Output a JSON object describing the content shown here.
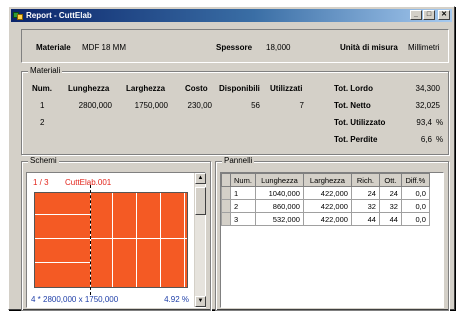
{
  "window": {
    "title": "Report - CuttElab",
    "icon": "app-icon",
    "buttons": [
      "minimize-icon",
      "maximize-icon",
      "close-icon"
    ]
  },
  "header": {
    "materiale_label": "Materiale",
    "materiale_value": "MDF 18 MM",
    "spessore_label": "Spessore",
    "spessore_value": "18,000",
    "unita_label": "Unità di misura",
    "unita_value": "Millimetri"
  },
  "materiali": {
    "title": "Materiali",
    "columns": [
      "Num.",
      "Lunghezza",
      "Larghezza",
      "Costo",
      "Disponibili",
      "Utilizzati"
    ],
    "rows": [
      [
        "1",
        "2800,000",
        "1750,000",
        "230,00",
        "56",
        "7"
      ],
      [
        "2",
        "",
        "",
        "",
        "",
        ""
      ]
    ],
    "totals": [
      {
        "label": "Tot. Lordo",
        "value": "34,300",
        "unit": ""
      },
      {
        "label": "Tot. Netto",
        "value": "32,025",
        "unit": ""
      },
      {
        "label": "Tot. Utilizzato",
        "value": "93,4",
        "unit": "%"
      },
      {
        "label": "Tot. Perdite",
        "value": "6,6",
        "unit": "%"
      }
    ]
  },
  "schemi": {
    "title": "Schemi",
    "page": "1 / 3",
    "name": "CuttElab.001",
    "footer_left": "4 * 2800,000 x 1750,000",
    "footer_right": "4.92 %",
    "sheet_color": "#f45a24",
    "accent_color": "#e2231a",
    "footer_color": "#1f3fa8"
  },
  "pannelli": {
    "title": "Pannelli",
    "columns": [
      "Num.",
      "Lunghezza",
      "Larghezza",
      "Rich.",
      "Ott.",
      "Diff.%"
    ],
    "rows": [
      [
        "1",
        "1040,000",
        "422,000",
        "24",
        "24",
        "0,0"
      ],
      [
        "2",
        "860,000",
        "422,000",
        "32",
        "32",
        "0,0"
      ],
      [
        "3",
        "532,000",
        "422,000",
        "44",
        "44",
        "0,0"
      ]
    ]
  }
}
